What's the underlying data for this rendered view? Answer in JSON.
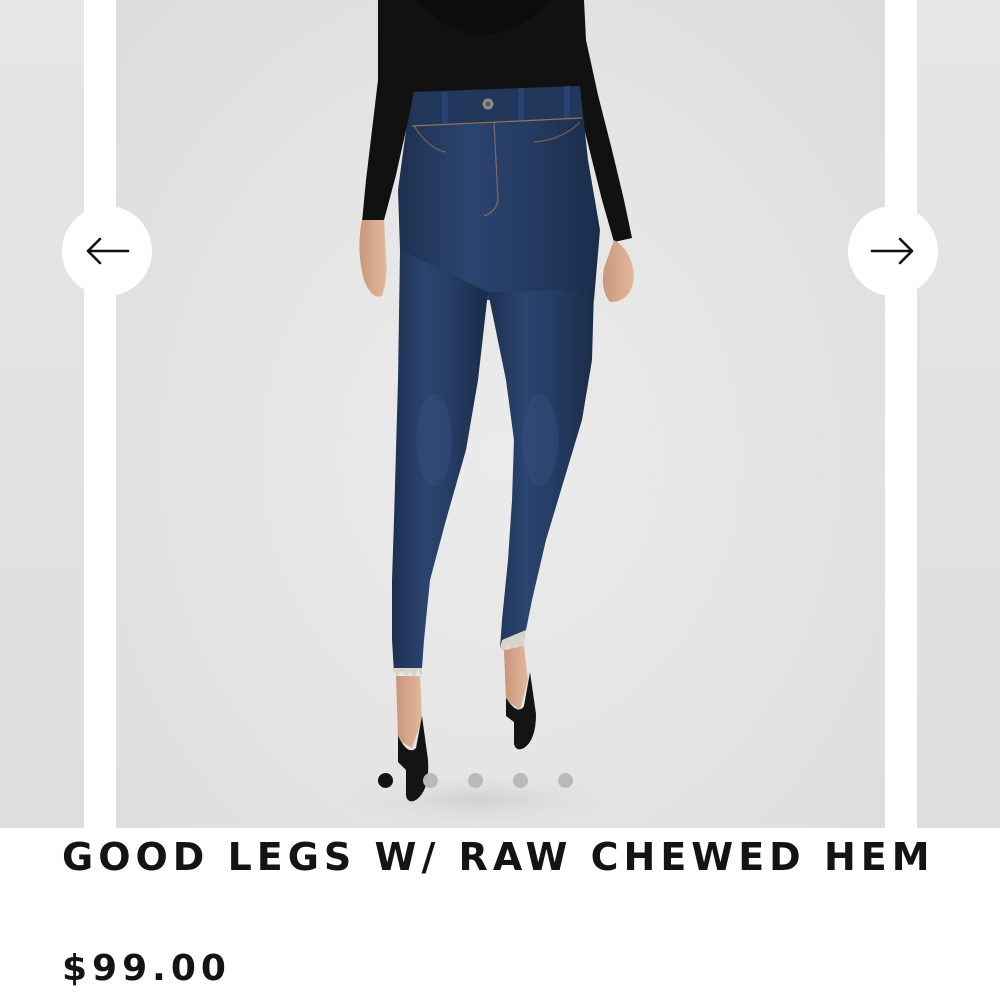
{
  "product": {
    "title": "GOOD LEGS W/ RAW CHEWED HEM",
    "price": "$99.00"
  },
  "carousel": {
    "prev_icon": "arrow-left-icon",
    "next_icon": "arrow-right-icon",
    "slide_count": 5,
    "active_slide": 1
  },
  "colors": {
    "background": "#ffffff",
    "slide_background": "#e4e4e4",
    "denim": "#253a5c",
    "top": "#111111",
    "dot_active": "#111111",
    "dot_inactive": "#b9b9b9",
    "text": "#141414"
  }
}
